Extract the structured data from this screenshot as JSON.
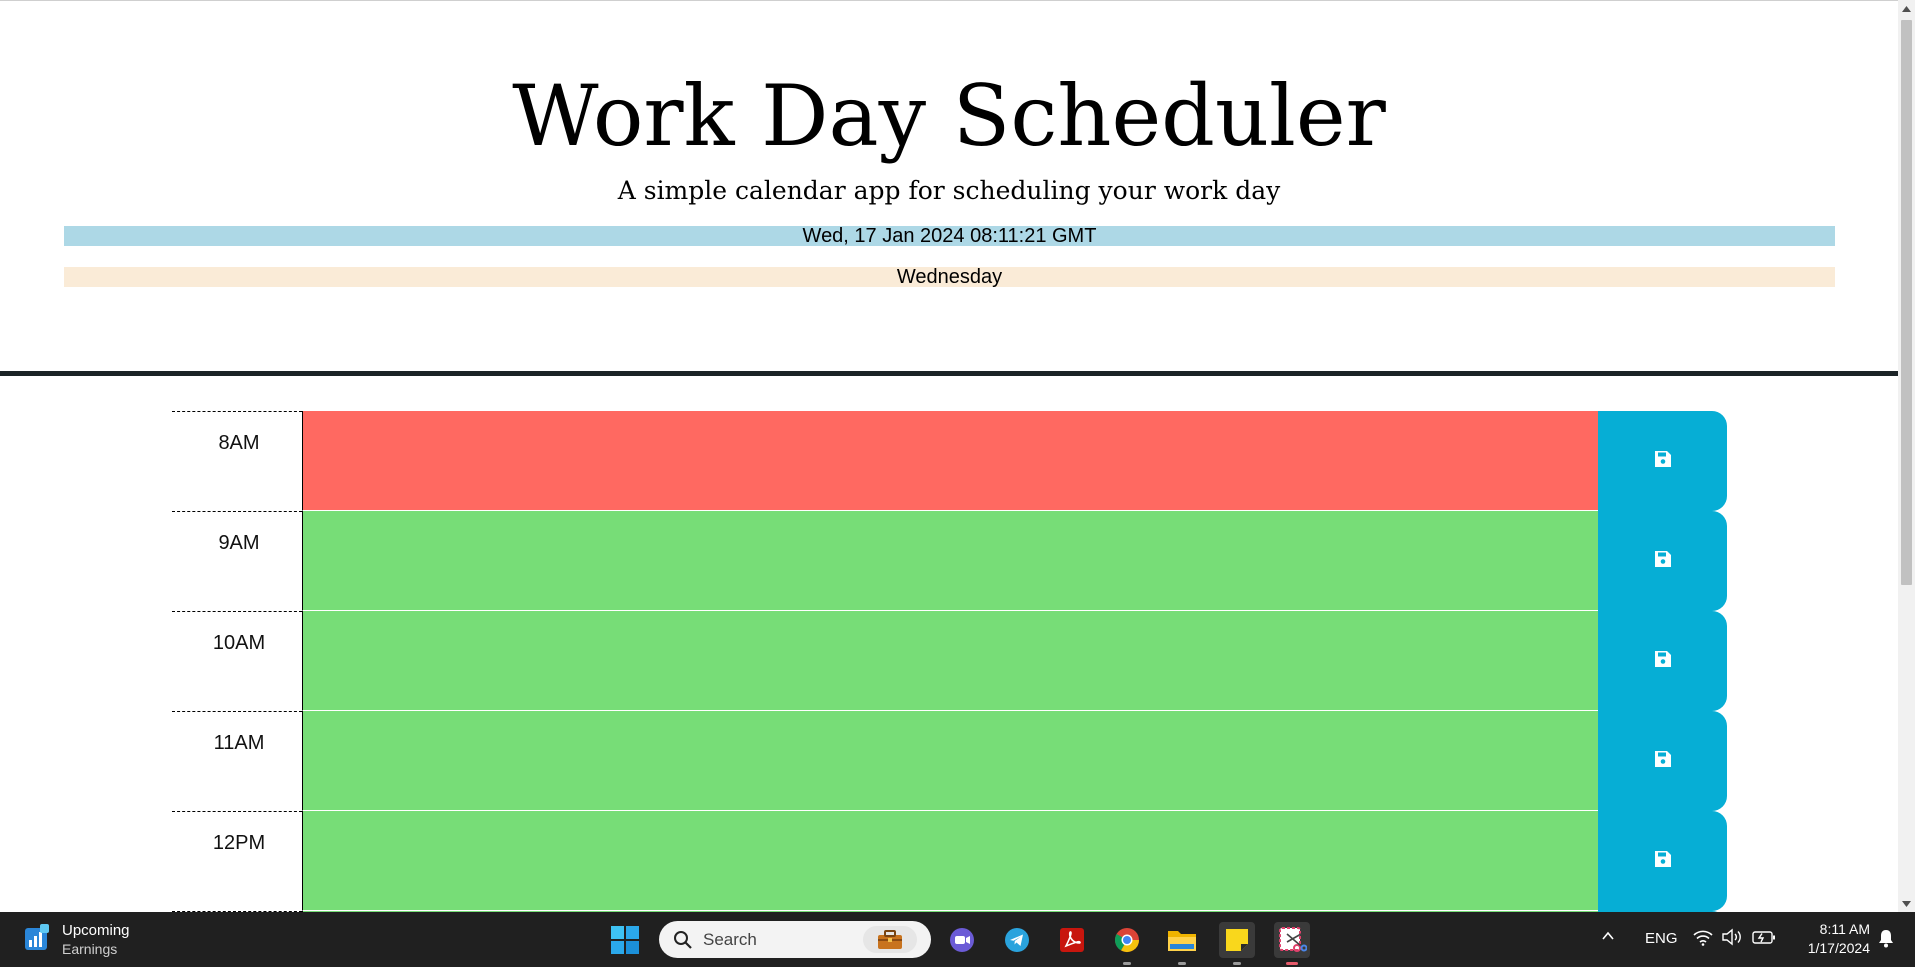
{
  "header": {
    "title": "Work Day Scheduler",
    "subtitle": "A simple calendar app for scheduling your work day",
    "datetime": "Wed, 17 Jan 2024 08:11:21 GMT",
    "day": "Wednesday"
  },
  "colors": {
    "present": "#ff6961",
    "future": "#77dd77",
    "save_button": "#06aed5",
    "datetime_bg": "#add8e6",
    "day_bg": "#faebd7",
    "divider": "#1b2326"
  },
  "timeblocks": [
    {
      "hour": "8AM",
      "status": "present",
      "text": "",
      "save_icon": "floppy-disk-icon"
    },
    {
      "hour": "9AM",
      "status": "future",
      "text": "",
      "save_icon": "floppy-disk-icon"
    },
    {
      "hour": "10AM",
      "status": "future",
      "text": "",
      "save_icon": "floppy-disk-icon"
    },
    {
      "hour": "11AM",
      "status": "future",
      "text": "",
      "save_icon": "floppy-disk-icon"
    },
    {
      "hour": "12PM",
      "status": "future",
      "text": "",
      "save_icon": "floppy-disk-icon"
    },
    {
      "hour": "",
      "status": "future",
      "text": "",
      "save_icon": "floppy-disk-icon"
    }
  ],
  "taskbar": {
    "widget": {
      "title": "Upcoming",
      "subtitle": "Earnings",
      "icon": "stock-chart-icon"
    },
    "search_placeholder": "Search",
    "apps": [
      {
        "name": "start-icon"
      },
      {
        "name": "briefcase-icon"
      },
      {
        "name": "meet-video-icon"
      },
      {
        "name": "telegram-icon"
      },
      {
        "name": "acrobat-icon"
      },
      {
        "name": "chrome-icon"
      },
      {
        "name": "file-explorer-icon"
      },
      {
        "name": "sticky-notes-icon"
      },
      {
        "name": "snipping-tool-icon"
      }
    ],
    "language": "ENG",
    "time": "8:11 AM",
    "date": "1/17/2024"
  }
}
